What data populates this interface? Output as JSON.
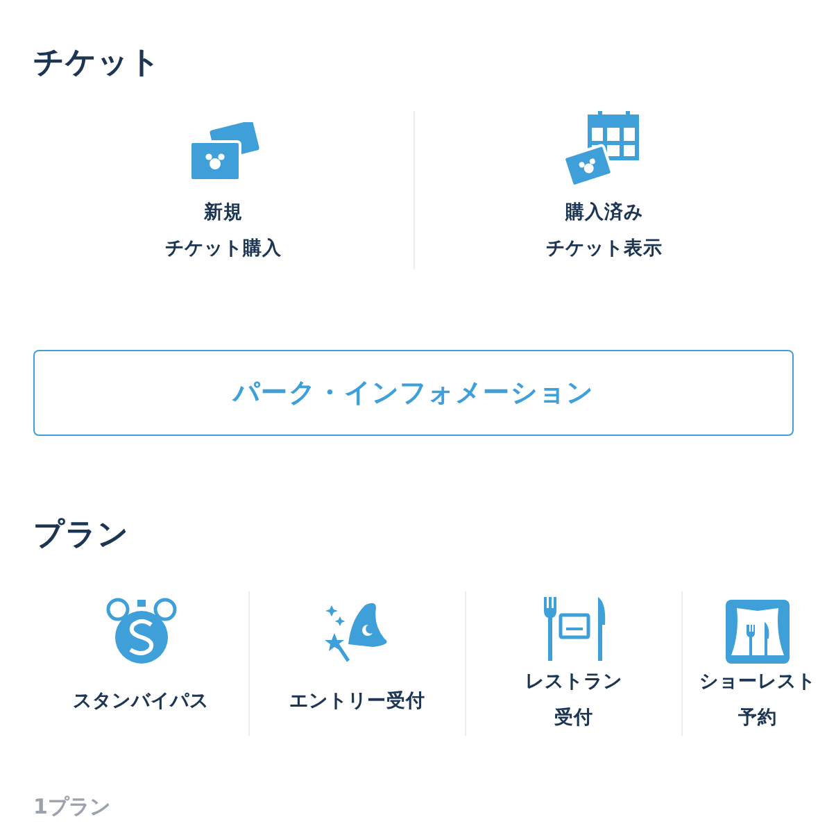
{
  "ticket_section": {
    "title": "チケット",
    "tiles": [
      {
        "lines": [
          "新規",
          "チケット購入"
        ]
      },
      {
        "lines": [
          "購入済み",
          "チケット表示"
        ]
      }
    ]
  },
  "park_info_button": {
    "label": "パーク・インフォメーション"
  },
  "plan_section": {
    "title": "プラン",
    "tiles": [
      {
        "lines": [
          "スタンバイパス"
        ]
      },
      {
        "lines": [
          "エントリー受付"
        ]
      },
      {
        "lines": [
          "レストラン",
          "受付"
        ]
      },
      {
        "lines": [
          "ショーレスト",
          "予約"
        ]
      }
    ]
  },
  "plan_count": "1プラン"
}
